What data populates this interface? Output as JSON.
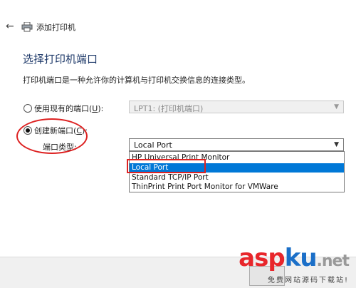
{
  "window": {
    "title": "添加打印机",
    "back_icon": "back-arrow-icon",
    "title_icon": "printer-icon"
  },
  "content": {
    "heading": "选择打印机端口",
    "description": "打印机端口是一种允许你的计算机与打印机交换信息的连接类型。",
    "existing_port": {
      "label_prefix": "使用现有的端口(",
      "label_key": "U",
      "label_suffix": "):",
      "checked": false,
      "select_value": "LPT1: (打印机端口)"
    },
    "new_port": {
      "label_prefix": "创建新端口(",
      "label_key": "C",
      "label_suffix": "):",
      "checked": true,
      "type_label": "端口类型:",
      "select_value": "Local Port",
      "options": [
        "HP Universal Print Monitor",
        "Local Port",
        "Standard TCP/IP Port",
        "ThinPrint Print Port Monitor for VMWare"
      ],
      "highlighted_index": 1
    }
  },
  "watermark": {
    "logo_a": "asp",
    "logo_k": "ku",
    "logo_n": ".net",
    "sub": "免费网站源码下载站!"
  },
  "colors": {
    "accent": "#0078d7",
    "annotation": "#dd2222",
    "heading": "#1f3a6a"
  }
}
